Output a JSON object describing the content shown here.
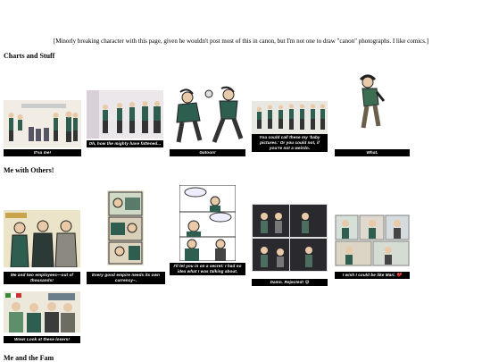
{
  "intro": "[Minorly breaking character with this page, given he wouldn't post most of this in canon, but I'm not one to draw \"canon\" photographs. I like comics.]",
  "sections": [
    {
      "title": "Charts and Stuff"
    },
    {
      "title": "Me with Others!"
    },
    {
      "title": "Me and the Fam"
    }
  ],
  "charts": [
    {
      "caption": "It'sa me!"
    },
    {
      "caption": "Oh, how the mighty have fattened..."
    },
    {
      "caption": "Gatoon!"
    },
    {
      "caption": "You could call these my 'baby pictures.' Or you could not, if you're not a weirdo."
    },
    {
      "caption": "What."
    }
  ],
  "others": [
    {
      "caption": "Me and two employees—out of thousands!"
    },
    {
      "caption": "Every good empire needs its own currency~."
    },
    {
      "caption": "I'll let you in on a secret: I had no idea what I was talking about."
    },
    {
      "caption": "Damn. Rejected! 😅"
    },
    {
      "caption": "I wish I could be like Mari. 💔"
    },
    {
      "caption": "Wow! Look at these losers!"
    }
  ],
  "colors": {
    "caption_bg": "#000000",
    "vest": "#2e5e50",
    "ink": "#222222",
    "skin": "#e8c9a8"
  }
}
